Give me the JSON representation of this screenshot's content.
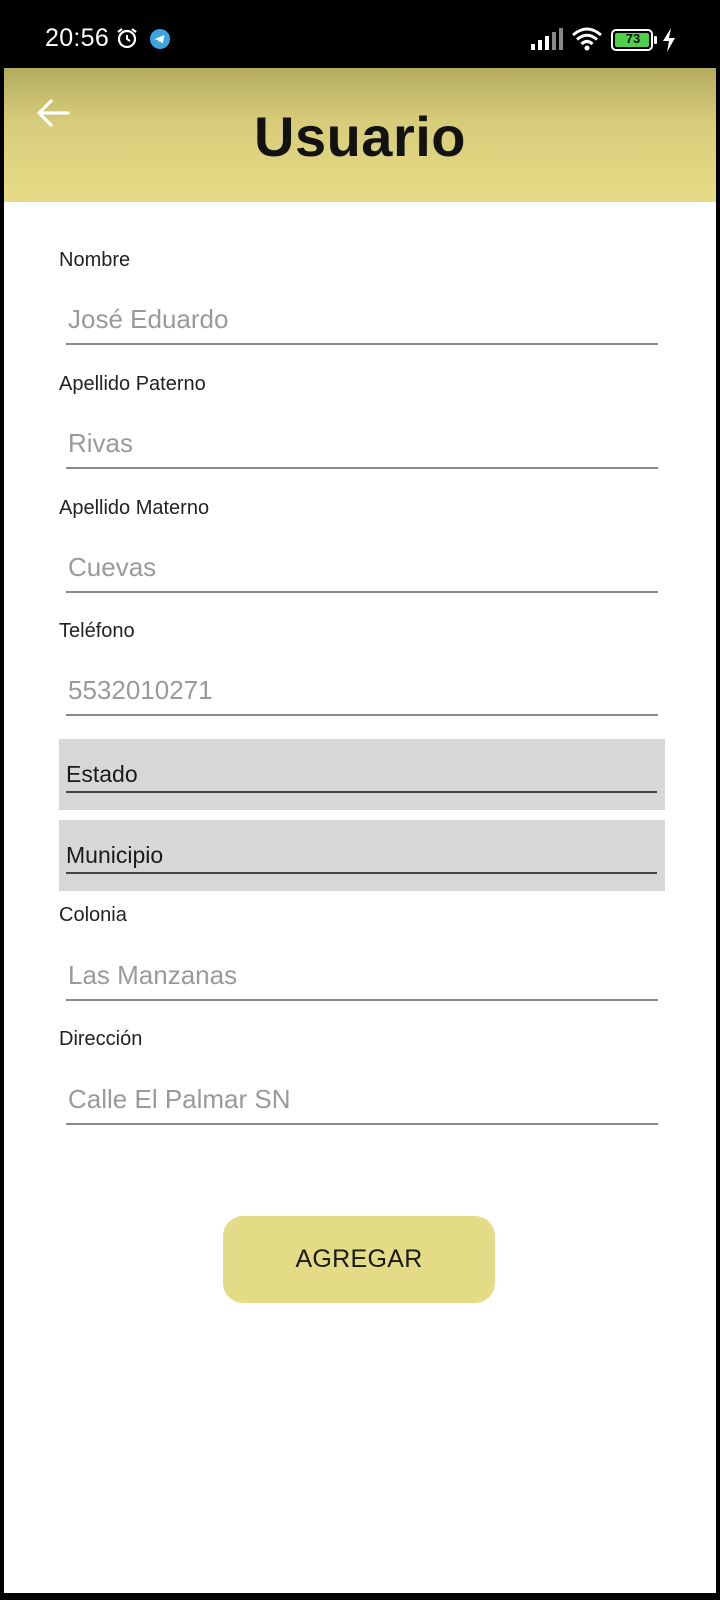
{
  "status_bar": {
    "time": "20:56",
    "battery": "73",
    "icons": [
      "alarm-icon",
      "telegram-icon",
      "signal-icon",
      "wifi-icon",
      "battery-icon",
      "charging-icon"
    ]
  },
  "header": {
    "title": "Usuario",
    "back_icon": "arrow-left-icon",
    "gradient_colors": [
      "#b4ab5e",
      "#e6db86"
    ]
  },
  "form": {
    "nombre": {
      "label": "Nombre",
      "placeholder": "José Eduardo"
    },
    "apellido_paterno": {
      "label": "Apellido Paterno",
      "placeholder": "Rivas"
    },
    "apellido_materno": {
      "label": "Apellido Materno",
      "placeholder": "Cuevas"
    },
    "telefono": {
      "label": "Teléfono",
      "placeholder": "5532010271"
    },
    "estado": {
      "value": "Estado"
    },
    "municipio": {
      "value": "Municipio"
    },
    "colonia": {
      "label": "Colonia",
      "placeholder": "Las Manzanas"
    },
    "direccion": {
      "label": "Dirección",
      "placeholder": "Calle El Palmar SN"
    }
  },
  "actions": {
    "add_label": "AGREGAR",
    "button_color": "#e4db86"
  }
}
